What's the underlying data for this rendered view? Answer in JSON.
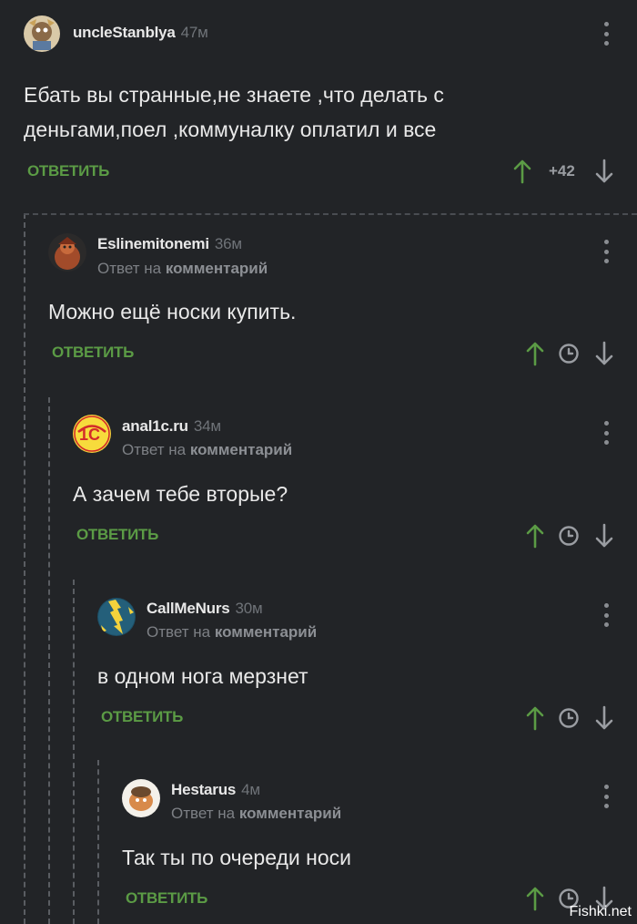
{
  "comments": [
    {
      "username": "uncleStanblya",
      "time": "47м",
      "text": "Ебать вы странные,не знаете ,что делать с деньгами,поел ,коммуналку оплатил и все",
      "reply_label": "ОТВЕТИТЬ",
      "score": "+42"
    },
    {
      "username": "Eslinemitonemi",
      "time": "36м",
      "reply_prefix": "Ответ на",
      "reply_target": "комментарий",
      "text": "Можно ещё носки купить.",
      "reply_label": "ОТВЕТИТЬ"
    },
    {
      "username": "anal1c.ru",
      "time": "34м",
      "reply_prefix": "Ответ на",
      "reply_target": "комментарий",
      "text": "А зачем тебе вторые?",
      "reply_label": "ОТВЕТИТЬ"
    },
    {
      "username": "CallMeNurs",
      "time": "30м",
      "reply_prefix": "Ответ на",
      "reply_target": "комментарий",
      "text": "в одном нога мерзнет",
      "reply_label": "ОТВЕТИТЬ"
    },
    {
      "username": "Hestarus",
      "time": "4м",
      "reply_prefix": "Ответ на",
      "reply_target": "комментарий",
      "text": "Так ты по очереди носи",
      "reply_label": "ОТВЕТИТЬ"
    }
  ],
  "watermark": "Fishki.net",
  "colors": {
    "background": "#222427",
    "accent_green": "#5b9b45",
    "muted": "#7d8085"
  }
}
